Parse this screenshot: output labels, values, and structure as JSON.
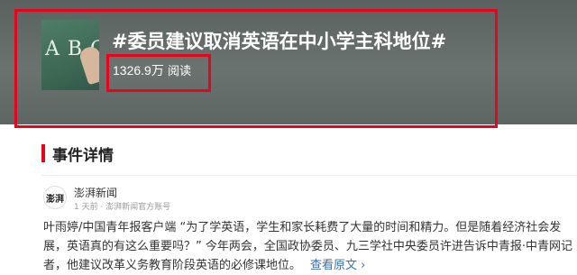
{
  "topic": {
    "title": "#委员建议取消英语在中小学主科地位#",
    "read_count": "1326.9万",
    "read_label": "阅读",
    "thumbnail_text": "A B C"
  },
  "section": {
    "title": "事件详情"
  },
  "source": {
    "avatar_text": "澎湃",
    "name": "澎湃新闻",
    "meta": "1 天前 · 澎湃新闻官方账号"
  },
  "article": {
    "body": "叶雨婷/中国青年报客户端 “为了学英语，学生和家长耗费了大量的时间和精力。但是随着经济社会发展，英语真的有这么重要吗？” 今年两会，全国政协委员、九三学社中央委员许进告诉中青报·中青网记者，他建议改革义务教育阶段英语的必修课地位。",
    "read_more": "查看原文 ›"
  },
  "colors": {
    "annotation_red": "#e3061e",
    "link_blue": "#3a6fb5",
    "banner_gray": "#636b68"
  }
}
